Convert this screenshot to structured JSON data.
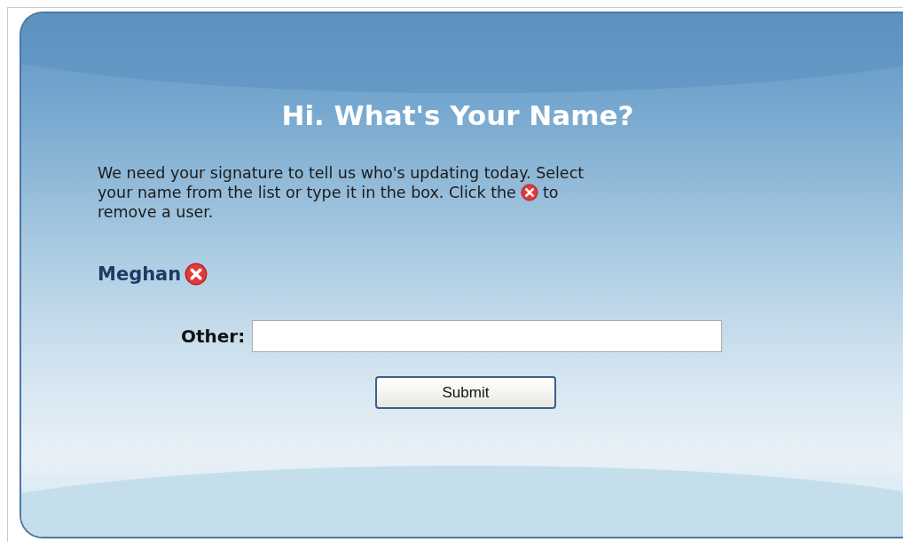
{
  "title": "Hi. What's Your Name?",
  "intro_lines": [
    [
      "We need your signature to tell us who's updating today. Select"
    ],
    [
      "your name from the list or type it in the box. Click the",
      "to"
    ],
    [
      "remove a user."
    ]
  ],
  "users": [
    {
      "name": "Meghan"
    }
  ],
  "other": {
    "label": "Other:"
  },
  "submit": "Submit"
}
